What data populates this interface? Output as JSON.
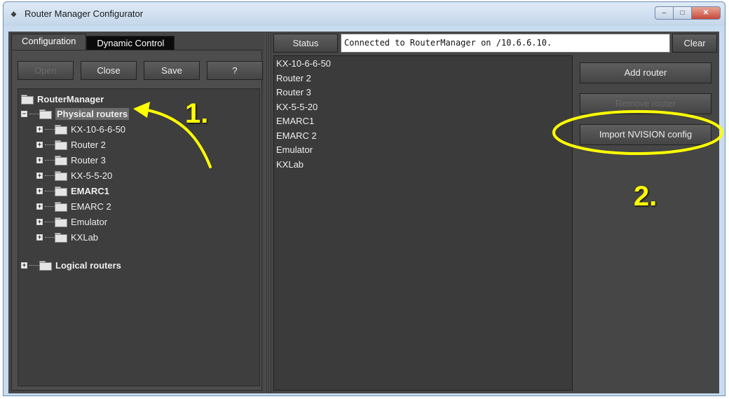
{
  "window": {
    "title": "Router Manager Configurator",
    "icon": "app-logo-icon",
    "controls": [
      "minimize",
      "maximize",
      "close"
    ]
  },
  "tabs": [
    {
      "label": "Configuration",
      "active": true
    },
    {
      "label": "Dynamic Control",
      "active": false
    }
  ],
  "toolbar": {
    "open": "Open",
    "close": "Close",
    "save": "Save",
    "help": "?"
  },
  "tree": {
    "root": "RouterManager",
    "physical": "Physical routers",
    "routers": [
      "KX-10-6-6-50",
      "Router 2",
      "Router 3",
      "KX-5-5-20",
      "EMARC1",
      "EMARC 2",
      "Emulator",
      "KXLab"
    ],
    "bold_router": "EMARC1",
    "logical": "Logical routers"
  },
  "status": {
    "button": "Status",
    "message": "Connected to RouterManager on /10.6.6.10.",
    "clear": "Clear"
  },
  "router_list": [
    "KX-10-6-6-50",
    "Router 2",
    "Router 3",
    "KX-5-5-20",
    "EMARC1",
    "EMARC 2",
    "Emulator",
    "KXLab"
  ],
  "actions": {
    "add": "Add router",
    "remove": "Remove router",
    "import": "Import NVISION config"
  },
  "callouts": {
    "step1": "1.",
    "step2": "2."
  },
  "colors": {
    "callout": "#ffff00",
    "panel": "#464646",
    "background": "#3a3a3a"
  }
}
